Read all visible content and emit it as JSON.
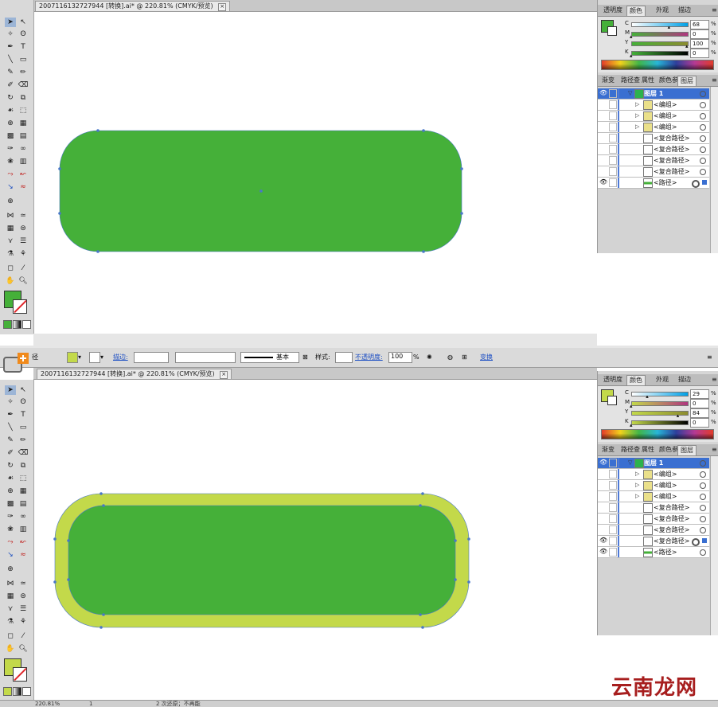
{
  "shot1": {
    "doc_tab": {
      "title": "2007116132727944 [转换].ai* @ 220.81% (CMYK/预览)",
      "close": "×"
    },
    "color_panel": {
      "tabs": [
        "透明度",
        "颜色",
        "外观",
        "描边"
      ],
      "active_tab": "颜色",
      "fill_color": "#45b039",
      "channels": [
        {
          "label": "C",
          "value": "68",
          "unit": "%",
          "fraction": 0.68
        },
        {
          "label": "M",
          "value": "0",
          "unit": "%",
          "fraction": 0.0
        },
        {
          "label": "Y",
          "value": "100",
          "unit": "%",
          "fraction": 1.0
        },
        {
          "label": "K",
          "value": "0",
          "unit": "%",
          "fraction": 0.0
        }
      ]
    },
    "layers_panel": {
      "tabs": [
        "渐变",
        "路径查",
        "属性",
        "颜色参",
        "图层"
      ],
      "active_tab": "图层",
      "rows": [
        {
          "name": "图层 1",
          "kind": "layer",
          "highlight": true
        },
        {
          "name": "<编组>",
          "kind": "group"
        },
        {
          "name": "<编组>",
          "kind": "group"
        },
        {
          "name": "<编组>",
          "kind": "group"
        },
        {
          "name": "<复合路径>",
          "kind": "compound"
        },
        {
          "name": "<复合路径>",
          "kind": "compound"
        },
        {
          "name": "<复合路径>",
          "kind": "compound"
        },
        {
          "name": "<复合路径>",
          "kind": "compound"
        },
        {
          "name": "<路径>",
          "kind": "path",
          "eye": true,
          "selected": true
        }
      ]
    },
    "shape": {
      "fill": "#45b039",
      "anchor_color": "#4a78c8"
    }
  },
  "shot2": {
    "control_bar": {
      "label_path": "径",
      "fill_color": "#c3d94a",
      "stroke_label": "描边:",
      "stroke_weight": "",
      "brush_label": "基本",
      "style_label": "样式:",
      "opacity_label": "不透明度:",
      "opacity_value": "100",
      "opacity_unit": "%",
      "transform_label": "变换"
    },
    "doc_tab": {
      "title": "2007116132727944 [转换].ai* @ 220.81% (CMYK/预览)",
      "close": "×"
    },
    "color_panel": {
      "tabs": [
        "透明度",
        "颜色",
        "外观",
        "描边"
      ],
      "active_tab": "颜色",
      "fill_color": "#c3d94a",
      "channels": [
        {
          "label": "C",
          "value": "29",
          "unit": "%",
          "fraction": 0.29
        },
        {
          "label": "M",
          "value": "0",
          "unit": "%",
          "fraction": 0.0
        },
        {
          "label": "Y",
          "value": "84",
          "unit": "%",
          "fraction": 0.84
        },
        {
          "label": "K",
          "value": "0",
          "unit": "%",
          "fraction": 0.0
        }
      ]
    },
    "layers_panel": {
      "tabs": [
        "渐变",
        "路径查",
        "属性",
        "颜色参",
        "图层"
      ],
      "active_tab": "图层",
      "rows": [
        {
          "name": "图层 1",
          "kind": "layer",
          "highlight": true
        },
        {
          "name": "<编组>",
          "kind": "group"
        },
        {
          "name": "<编组>",
          "kind": "group"
        },
        {
          "name": "<编组>",
          "kind": "group"
        },
        {
          "name": "<复合路径>",
          "kind": "compound"
        },
        {
          "name": "<复合路径>",
          "kind": "compound"
        },
        {
          "name": "<复合路径>",
          "kind": "compound"
        },
        {
          "name": "<复合路径>",
          "kind": "compound",
          "eye": true,
          "selected": true
        },
        {
          "name": "<路径>",
          "kind": "path",
          "eye": true
        }
      ]
    },
    "shape": {
      "outer_fill": "#c3d94a",
      "inner_fill": "#45b039",
      "anchor_color": "#4a78c8"
    },
    "status": {
      "zoom": "220.81%",
      "page": "1",
      "hint": "2 次还原；不再能"
    }
  },
  "watermark": "云南龙网"
}
